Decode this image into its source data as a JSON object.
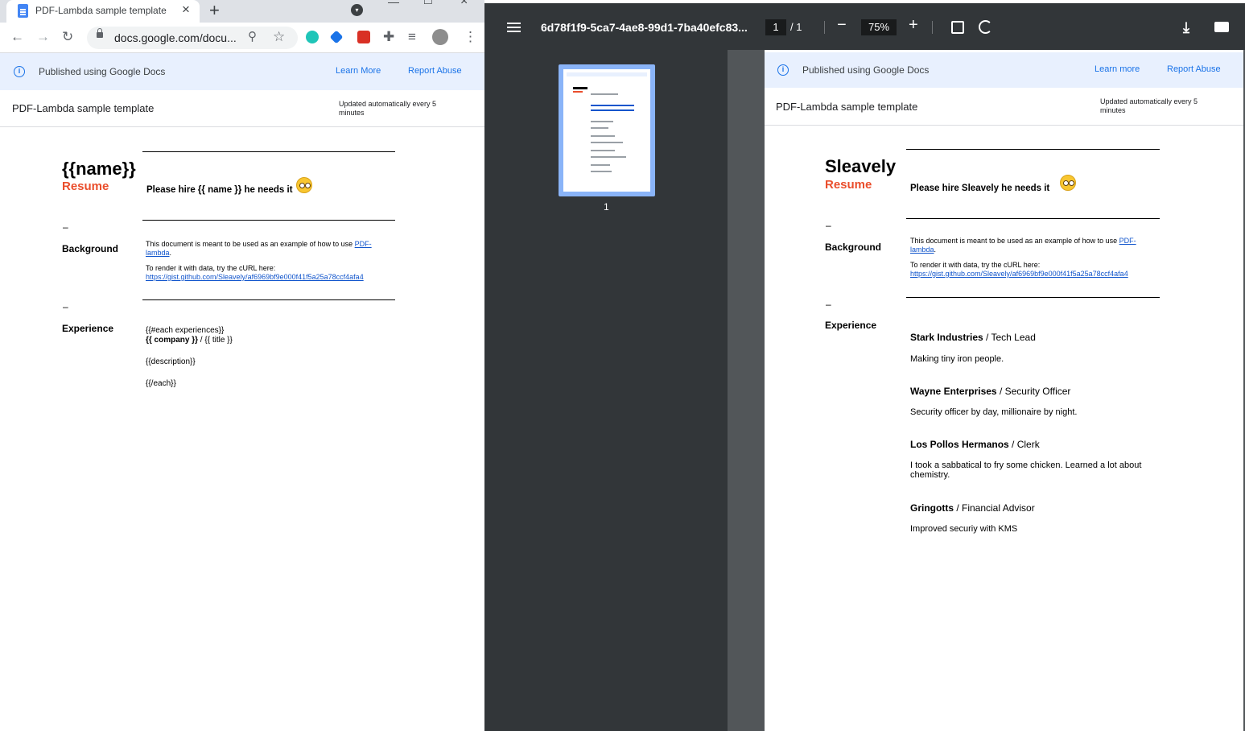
{
  "browser": {
    "tab_title": "PDF-Lambda sample template",
    "url": "docs.google.com/docu..."
  },
  "banner": {
    "text": "Published using Google Docs",
    "learn_more": "Learn More",
    "report_abuse": "Report Abuse"
  },
  "doc": {
    "title": "PDF-Lambda sample template",
    "updated": "Updated automatically every 5 minutes"
  },
  "template": {
    "name": "{{name}}",
    "resume": "Resume",
    "hire": "Please hire {{ name }} he needs it",
    "dash": "–",
    "background_heading": "Background",
    "bg_text_1": "This document is meant to be used as an example of how to use ",
    "bg_link_1": "PDF-lambda",
    "bg_text_2": "To render it with data, try the cURL here:",
    "bg_link_2": "https://gist.github.com/Sleavely/af6969bf9e000f41f5a25a78ccf4afa4",
    "experience_heading": "Experience",
    "each_open": "{{#each experiences}}",
    "company": "{{ company }}",
    "title_sep": " / {{ title }}",
    "description": "{{description}}",
    "each_close": "{{/each}}"
  },
  "pdf_viewer": {
    "file_name": "6d78f1f9-5ca7-4ae8-99d1-7ba40efc83...",
    "page_current": "1",
    "page_total": "/ 1",
    "zoom": "75%",
    "thumb_label": "1"
  },
  "pdf_page": {
    "banner_text": "Published using Google Docs",
    "learn_more": "Learn more",
    "report_abuse": "Report Abuse",
    "title": "PDF-Lambda sample template",
    "updated": "Updated automatically every 5 minutes",
    "name": "Sleavely",
    "resume": "Resume",
    "hire": "Please hire Sleavely he needs it",
    "background_heading": "Background",
    "experience_heading": "Experience",
    "experiences": [
      {
        "company": "Stark Industries",
        "title": " / Tech Lead",
        "description": "Making tiny iron people."
      },
      {
        "company": "Wayne Enterprises",
        "title": " / Security Officer",
        "description": "Security officer by day, millionaire by night."
      },
      {
        "company": "Los Pollos Hermanos",
        "title": " / Clerk",
        "description": "I took a sabbatical to fry some chicken. Learned a lot about chemistry."
      },
      {
        "company": "Gringotts",
        "title": " / Financial Advisor",
        "description": "Improved securiy with KMS"
      }
    ]
  }
}
